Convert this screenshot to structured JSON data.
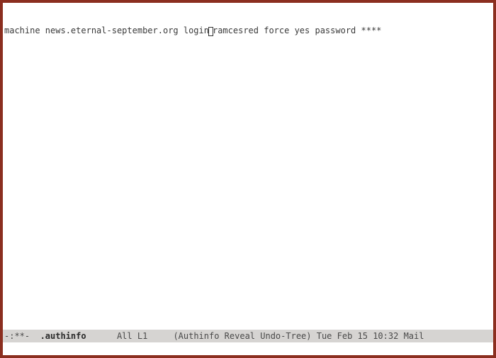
{
  "buffer": {
    "pre_cursor": "machine news.eternal-september.org login",
    "post_cursor": "ramcesred force yes password ****"
  },
  "modeline": {
    "status": "-:**-  ",
    "filename": ".authinfo",
    "position": "      All L1     ",
    "modes": "(Authinfo Reveal Undo-Tree) ",
    "datetime": "Tue Feb 15 10:32 ",
    "extra": "Mail"
  },
  "minibuffer": ""
}
